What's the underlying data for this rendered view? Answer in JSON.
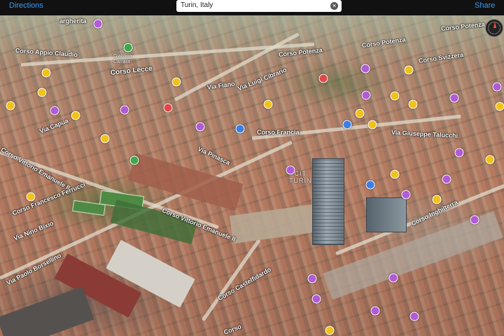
{
  "toolbar": {
    "directions_label": "Directions",
    "search_value": "Turin, Italy",
    "share_label": "Share"
  },
  "map": {
    "streets": [
      "argherita",
      "Corso Appio Claudio",
      "Corso Lecce",
      "Via Capua",
      "Corso Vittorio Emanuele II",
      "Corso Francesco Ferrucci",
      "Via Nino Bixio",
      "Via Paolo Borsellino",
      "Corso Vittorio Emanuele II",
      "Corso Castelfidardo",
      "Via Pinasca",
      "Corso Francia",
      "Via Fiano",
      "Via Luigi Cibrario",
      "Corso Potenza",
      "Corso Potenza",
      "Corso Potenza",
      "Corso Svizzera",
      "Via Giuseppe Talucchi",
      "Corso Inghilterra",
      "Corso"
    ],
    "district_label": "CIT\nTURIN",
    "poi_label": "Giardino\nCarrara"
  },
  "icons": {
    "clear": "clear-search-icon",
    "compass": "compass-icon",
    "pin": "poi-pin-icon"
  },
  "colors": {
    "toolbar_bg": "#111111",
    "link": "#3a9af5",
    "pin_yellow": "#f2c21b",
    "pin_purple": "#b35ad8",
    "pin_blue": "#3c7ee6",
    "pin_red": "#e04848",
    "pin_green": "#3ea84a"
  }
}
